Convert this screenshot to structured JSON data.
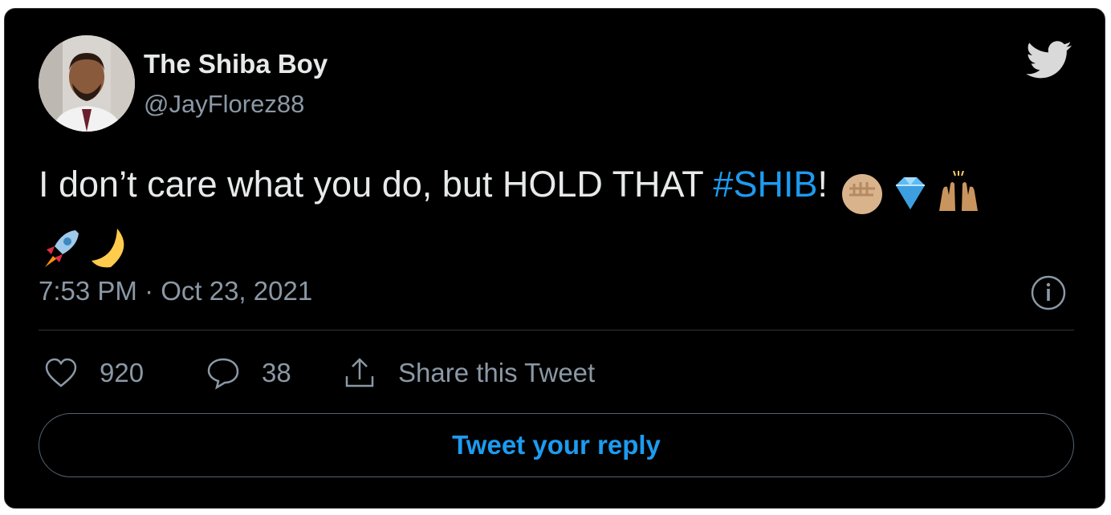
{
  "author": {
    "name": "The Shiba Boy",
    "handle": "@JayFlorez88"
  },
  "tweet": {
    "text_before": "I don’t care what you do, but HOLD THAT ",
    "hashtag": "#SHIB",
    "text_after": "! ",
    "emojis": [
      "raised-fist-emoji",
      "gem-emoji",
      "raising-hands-emoji",
      "rocket-emoji",
      "crescent-moon-emoji"
    ],
    "timestamp": "7:53 PM · Oct 23, 2021"
  },
  "actions": {
    "likes": "920",
    "replies": "38",
    "share_label": "Share this Tweet"
  },
  "reply_button_label": "Tweet your reply",
  "colors": {
    "background": "#000000",
    "accent": "#1d9bf0",
    "secondary_text": "#8b98a5",
    "primary_text": "#e7e9ea"
  },
  "icons": [
    "twitter-bird-icon",
    "info-icon",
    "heart-icon",
    "reply-bubble-icon",
    "share-icon"
  ]
}
